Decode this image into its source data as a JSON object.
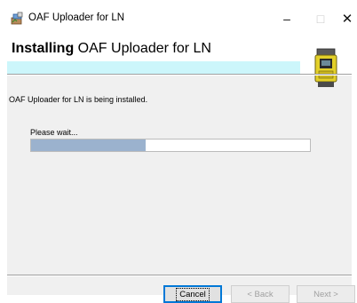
{
  "window": {
    "title": "OAF Uploader for LN",
    "controls": {
      "minimize": "–",
      "maximize": "□",
      "close": "✕"
    }
  },
  "header": {
    "title_bold": "Installing",
    "title_rest": " OAF Uploader for LN",
    "accent_color": "#ccf6fb"
  },
  "body": {
    "status": "OAF Uploader for LN  is being installed.",
    "wait": "Please wait...",
    "progress": 0.41
  },
  "buttons": {
    "cancel": "Cancel",
    "back": "< Back",
    "next": "Next >"
  },
  "icons": {
    "app": "installer-package-icon",
    "product": "survey-instrument-image"
  }
}
